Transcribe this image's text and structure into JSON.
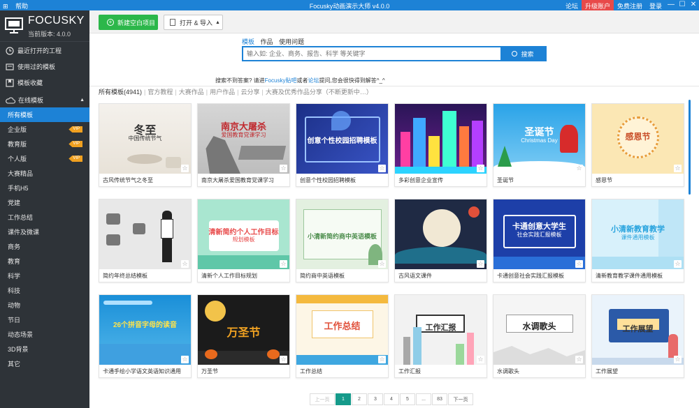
{
  "titlebar": {
    "menu": [
      "帮助"
    ],
    "title": "Focusky动画演示大师 v4.0.0",
    "links": [
      "论坛",
      "升级账户",
      "免费注册",
      "登录"
    ],
    "controls": [
      "—",
      "☐",
      "✕"
    ]
  },
  "sidebar": {
    "brand": "FOCUSKY",
    "version": "当前版本: 4.0.0",
    "top_items": [
      {
        "label": "最近打开的工程",
        "icon": "clock-icon"
      },
      {
        "label": "使用过的模板",
        "icon": "template-icon"
      },
      {
        "label": "模板收藏",
        "icon": "bookmark-icon"
      }
    ],
    "section": {
      "label": "在线模板",
      "icon": "cloud-icon",
      "caret": "▲"
    },
    "categories": [
      {
        "label": "所有模板",
        "active": true,
        "vip": ""
      },
      {
        "label": "企业版",
        "vip": "VIP"
      },
      {
        "label": "教育版",
        "vip": "VIP"
      },
      {
        "label": "个人版",
        "vip": "VIP"
      },
      {
        "label": "大赛精品",
        "vip": ""
      },
      {
        "label": "手机H5",
        "vip": ""
      },
      {
        "label": "党建",
        "vip": ""
      },
      {
        "label": "工作总结",
        "vip": ""
      },
      {
        "label": "课件及微课",
        "vip": ""
      },
      {
        "label": "商务",
        "vip": ""
      },
      {
        "label": "教育",
        "vip": ""
      },
      {
        "label": "科学",
        "vip": ""
      },
      {
        "label": "科技",
        "vip": ""
      },
      {
        "label": "动物",
        "vip": ""
      },
      {
        "label": "节日",
        "vip": ""
      },
      {
        "label": "动态场景",
        "vip": ""
      },
      {
        "label": "3D背景",
        "vip": ""
      },
      {
        "label": "其它",
        "vip": ""
      }
    ]
  },
  "toolbar": {
    "new_label": "新建空白项目",
    "open_label": "打开 & 导入"
  },
  "search": {
    "tabs": [
      "模板",
      "作品",
      "使用问题"
    ],
    "placeholder": "输入如: 企业、商务、报告、科学 等关键字",
    "button": "搜索",
    "hint_prefix": "搜索不到答案? 请进",
    "hint_link1": "Focusky贴吧",
    "hint_mid": "或者",
    "hint_link2": "论坛",
    "hint_suffix": "提问,您会很快得到解答^_^"
  },
  "filter": {
    "current": "所有模板(4941)",
    "options": [
      "官方教程",
      "大赛作品",
      "用户作品",
      "云分享",
      "大赛及优秀作品分享（不断更新中…）"
    ]
  },
  "templates": [
    {
      "name": "古风传统节气之冬至",
      "thumb_title": "冬至",
      "thumb_sub": "中国传统节气",
      "theme": "dongzhi"
    },
    {
      "name": "南京大屠杀爱国教育党课学习",
      "thumb_title": "南京大屠杀",
      "thumb_sub": "爱国教育党课学习",
      "theme": "nanjing"
    },
    {
      "name": "创意个性校园招聘模板",
      "thumb_title": "创意个性校园招聘模板",
      "thumb_sub": "",
      "theme": "zhaopin"
    },
    {
      "name": "多彩创意企业宣传",
      "thumb_title": "",
      "thumb_sub": "",
      "theme": "city"
    },
    {
      "name": "圣诞节",
      "thumb_title": "圣诞节",
      "thumb_sub": "Christmas Day",
      "theme": "xmas"
    },
    {
      "name": "感恩节",
      "thumb_title": "感恩节",
      "thumb_sub": "",
      "theme": "thanks"
    },
    {
      "name": "简约年终总结模板",
      "thumb_title": "",
      "thumb_sub": "",
      "theme": "nianzhong"
    },
    {
      "name": "清新个人工作目标规划",
      "thumb_title": "清新简约个人工作目标",
      "thumb_sub": "规划模板",
      "theme": "qingxin"
    },
    {
      "name": "简约商中英语模板",
      "thumb_title": "小清新简约商中英语模板",
      "thumb_sub": "",
      "theme": "english"
    },
    {
      "name": "古风语文课件",
      "thumb_title": "",
      "thumb_sub": "",
      "theme": "gufeng"
    },
    {
      "name": "卡通创意社会实践汇报模板",
      "thumb_title": "卡通创意大学生",
      "thumb_sub": "社会实践汇报模板",
      "theme": "shijian"
    },
    {
      "name": "清新教育教学课件通用模板",
      "thumb_title": "小清新教育教学",
      "thumb_sub": "课件通用模板",
      "theme": "jiaoyu"
    },
    {
      "name": "卡通手绘小学语文英语知识通用",
      "thumb_title": "26个拼音字母的读音",
      "thumb_sub": "",
      "theme": "pinyin"
    },
    {
      "name": "万圣节",
      "thumb_title": "万圣节",
      "thumb_sub": "",
      "theme": "halloween"
    },
    {
      "name": "工作总结",
      "thumb_title": "工作总结",
      "thumb_sub": "",
      "theme": "zongjie"
    },
    {
      "name": "工作汇报",
      "thumb_title": "工作汇报",
      "thumb_sub": "",
      "theme": "huibao"
    },
    {
      "name": "水调歌头",
      "thumb_title": "水调歌头",
      "thumb_sub": "",
      "theme": "shuidiao"
    },
    {
      "name": "工作展望",
      "thumb_title": "工作展望",
      "thumb_sub": "",
      "theme": "zhanwang"
    }
  ],
  "pager": {
    "prev": "上一页",
    "pages": [
      "1",
      "2",
      "3",
      "4",
      "5",
      "...",
      "83"
    ],
    "current": "1",
    "next": "下一页"
  },
  "colors": {
    "accent": "#1d82d6",
    "sidebar_bg": "#2e3338",
    "new_button": "#2cb74a",
    "upgrade": "#e84a4a",
    "vip": "#f0a020",
    "pager_active": "#159a8a"
  }
}
